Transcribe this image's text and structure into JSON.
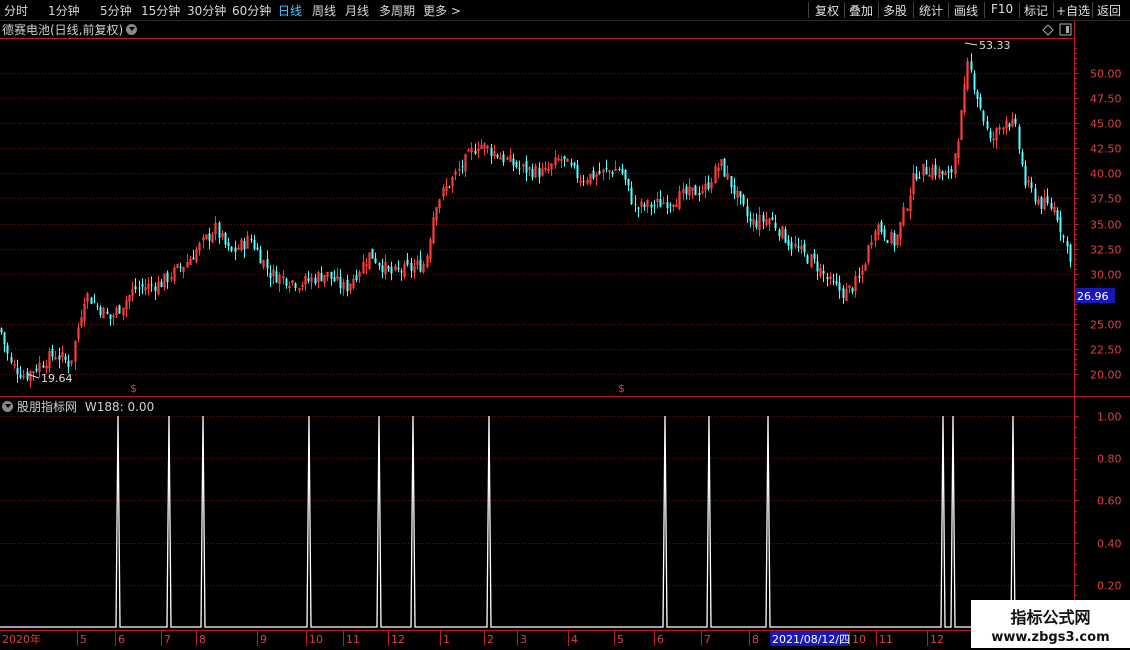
{
  "toolbar": {
    "left_items": [
      {
        "label": "分时",
        "active": false
      },
      {
        "label": "1分钟",
        "active": false
      },
      {
        "label": "5分钟",
        "active": false
      },
      {
        "label": "15分钟",
        "active": false
      },
      {
        "label": "30分钟",
        "active": false
      },
      {
        "label": "60分钟",
        "active": false
      },
      {
        "label": "日线",
        "active": true
      },
      {
        "label": "周线",
        "active": false
      },
      {
        "label": "月线",
        "active": false
      },
      {
        "label": "多周期",
        "active": false
      },
      {
        "label": "更多 >",
        "active": false
      }
    ],
    "right_items": [
      "复权",
      "叠加",
      "多股",
      "统计",
      "画线",
      "F10",
      "标记",
      "+自选",
      "返回"
    ]
  },
  "price_panel": {
    "title": "德赛电池(日线,前复权)",
    "y_ticks": [
      "50.00",
      "47.50",
      "45.00",
      "42.50",
      "40.00",
      "37.50",
      "35.00",
      "32.50",
      "30.00",
      "25.00",
      "22.50",
      "20.00"
    ],
    "current_price": "26.96",
    "high_label": "53.33",
    "low_label": "19.64",
    "event_marker": "$"
  },
  "indicator_panel": {
    "title": "股朋指标网",
    "series_name": "W188:",
    "series_value": "0.00",
    "y_ticks": [
      "1.00",
      "0.80",
      "0.60",
      "0.40",
      "0.20"
    ]
  },
  "time_axis": {
    "labels": [
      "2020年",
      "5",
      "6",
      "7",
      "8",
      "9",
      "10",
      "11",
      "12",
      "1",
      "2",
      "3",
      "4",
      "5",
      "6",
      "7",
      "8",
      "10",
      "11",
      "12"
    ],
    "cursor_date": "2021/08/12/四"
  },
  "watermark": {
    "line1": "指标公式网",
    "line2": "www.zbgs3.com"
  },
  "colors": {
    "up": "#ff3c3c",
    "down": "#54ffff",
    "grid": "#7a0f0f",
    "axis": "#c0191e",
    "ind_line": "#ffffff",
    "active": "#4ec8ff"
  },
  "chart_data": [
    {
      "type": "candlestick",
      "title": "德赛电池(日线,前复权)",
      "ylim": [
        19.0,
        54.5
      ],
      "y_ticks": [
        20.0,
        22.5,
        25.0,
        30.0,
        32.5,
        35.0,
        37.5,
        40.0,
        42.5,
        45.0,
        47.5,
        50.0
      ],
      "annotations": [
        {
          "label": "53.33",
          "value": 53.33
        },
        {
          "label": "19.64",
          "value": 19.64
        }
      ],
      "last_price": 26.96,
      "close_path": [
        [
          0,
          24.5
        ],
        [
          10,
          21.0
        ],
        [
          25,
          19.8
        ],
        [
          40,
          21.0
        ],
        [
          55,
          22.0
        ],
        [
          70,
          21.0
        ],
        [
          85,
          28.0
        ],
        [
          110,
          25.5
        ],
        [
          135,
          28.5
        ],
        [
          160,
          29.0
        ],
        [
          185,
          31.0
        ],
        [
          215,
          34.5
        ],
        [
          230,
          32.0
        ],
        [
          250,
          33.5
        ],
        [
          270,
          30.0
        ],
        [
          300,
          29.0
        ],
        [
          325,
          30.0
        ],
        [
          345,
          28.5
        ],
        [
          370,
          32.0
        ],
        [
          390,
          30.0
        ],
        [
          410,
          30.5
        ],
        [
          425,
          31.0
        ],
        [
          435,
          37.0
        ],
        [
          460,
          40.5
        ],
        [
          478,
          43.0
        ],
        [
          495,
          42.0
        ],
        [
          520,
          40.5
        ],
        [
          545,
          40.0
        ],
        [
          560,
          41.5
        ],
        [
          580,
          39.5
        ],
        [
          600,
          40.0
        ],
        [
          620,
          40.5
        ],
        [
          635,
          36.5
        ],
        [
          660,
          37.0
        ],
        [
          690,
          38.0
        ],
        [
          705,
          38.5
        ],
        [
          720,
          41.0
        ],
        [
          735,
          38.0
        ],
        [
          750,
          35.0
        ],
        [
          770,
          35.5
        ],
        [
          790,
          33.0
        ],
        [
          815,
          31.0
        ],
        [
          830,
          29.0
        ],
        [
          845,
          28.0
        ],
        [
          860,
          29.5
        ],
        [
          875,
          35.0
        ],
        [
          895,
          33.0
        ],
        [
          915,
          40.0
        ],
        [
          930,
          40.5
        ],
        [
          950,
          39.5
        ],
        [
          960,
          45.0
        ],
        [
          968,
          51.0
        ],
        [
          975,
          48.5
        ],
        [
          990,
          43.0
        ],
        [
          1005,
          45.5
        ],
        [
          1015,
          44.5
        ],
        [
          1025,
          39.0
        ],
        [
          1040,
          37.0
        ],
        [
          1055,
          36.5
        ],
        [
          1065,
          33.0
        ],
        [
          1075,
          30.5
        ]
      ]
    },
    {
      "type": "line",
      "series": [
        {
          "name": "W188",
          "spikes": [
            {
              "time": "2020-06",
              "value": 1.0
            },
            {
              "time": "2020-07",
              "value": 1.0
            },
            {
              "time": "2020-08",
              "value": 1.0
            },
            {
              "time": "2020-10",
              "value": 1.0
            },
            {
              "time": "2020-11",
              "value": 1.0
            },
            {
              "time": "2020-12",
              "value": 1.0
            },
            {
              "time": "2021-02",
              "value": 1.0
            },
            {
              "time": "2021-06",
              "value": 1.0
            },
            {
              "time": "2021-07",
              "value": 1.0
            },
            {
              "time": "2021-08",
              "value": 1.0
            },
            {
              "time": "2021-12",
              "value": 1.0
            },
            {
              "time": "2021-12",
              "value": 1.0
            },
            {
              "time": "2022-01",
              "value": 1.0
            }
          ]
        }
      ],
      "ylim": [
        0,
        1.0
      ],
      "y_ticks": [
        0.2,
        0.4,
        0.6,
        0.8,
        1.0
      ]
    }
  ]
}
